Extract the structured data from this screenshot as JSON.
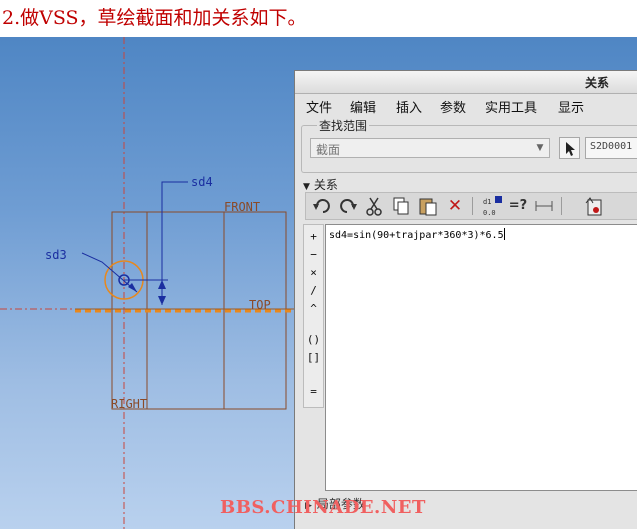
{
  "caption": "2.做VSS，草绘截面和加关系如下。",
  "sketch": {
    "dim_labels": [
      "sd4",
      "sd3"
    ],
    "datum_labels": [
      "FRONT",
      "TOP",
      "RIGHT"
    ]
  },
  "dialog": {
    "title": "关系",
    "menu": [
      "文件",
      "编辑",
      "插入",
      "参数",
      "实用工具",
      "显示"
    ],
    "search_scope": {
      "legend": "查找范围",
      "type_value": "截面",
      "item_value": "S2D0001"
    },
    "relations_header": "关系",
    "toolbar_icons": [
      "undo-icon",
      "redo-icon",
      "cut-icon",
      "copy-icon",
      "paste-icon",
      "delete-icon",
      "switch-dimensions-icon",
      "evaluate-icon",
      "unit-length-icon",
      "verify-icon"
    ],
    "evaluate_label": "=?",
    "operators": [
      "+",
      "−",
      "×",
      "/",
      "^",
      "()",
      "[]",
      "="
    ],
    "relation_text": "sd4=sin(90+trajpar*360*3)*6.5",
    "local_params_label": "局部参数"
  },
  "watermark": "BBS.CHINADE.NET",
  "colors": {
    "caption_text": "#c00000",
    "sketch_line": "#8a4a28",
    "dimension_line": "#1a2ea0",
    "trajectory": "#e8881c",
    "watermark": "#f06060"
  }
}
